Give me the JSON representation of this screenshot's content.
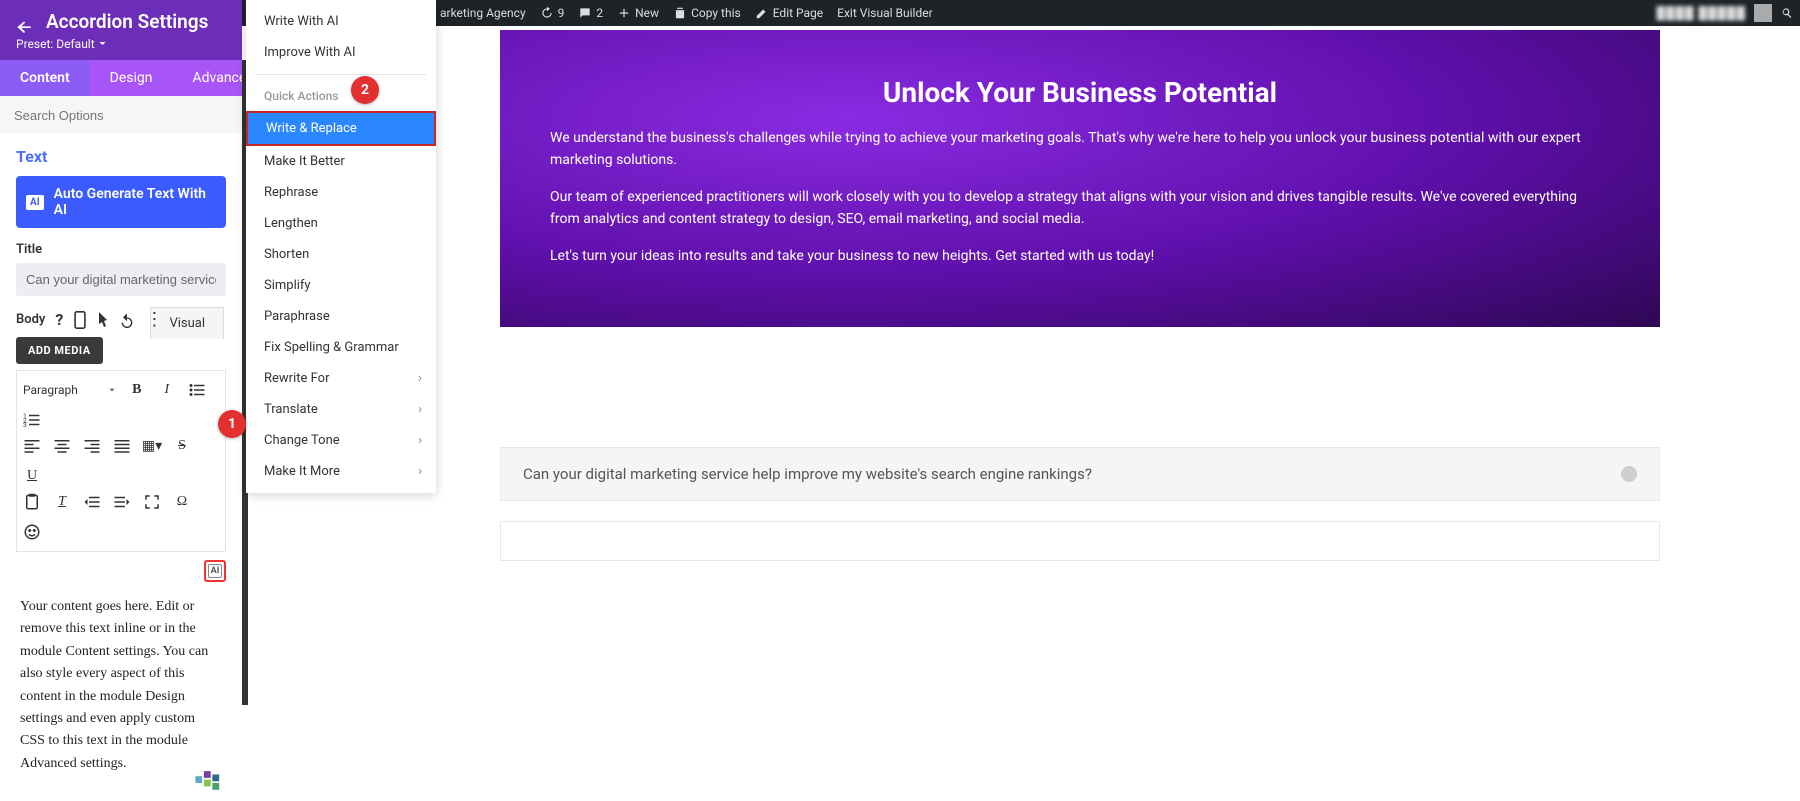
{
  "wpbar": {
    "site": "arketing Agency",
    "updates": "9",
    "comments": "2",
    "new": "New",
    "copy": "Copy this",
    "edit": "Edit Page",
    "exit": "Exit Visual Builder",
    "user_blur": "████ █████"
  },
  "panel": {
    "title": "Accordion Settings",
    "preset": "Preset: Default",
    "tabs": {
      "content": "Content",
      "design": "Design",
      "advanced": "Advanced"
    },
    "search_ph": "Search Options",
    "section": "Text",
    "auto_btn": "Auto Generate Text With AI",
    "title_lbl": "Title",
    "title_val": "Can your digital marketing service help improve my website's search engine rankings?",
    "body_lbl": "Body",
    "add_media": "ADD MEDIA",
    "visual": "Visual",
    "para": "Paragraph",
    "editor_body": "Your content goes here. Edit or remove this text inline or in the module Content settings. You can also style every aspect of this content in the module Design settings and even apply custom CSS to this text in the module Advanced settings."
  },
  "ai_menu": {
    "write_ai": "Write With AI",
    "improve_ai": "Improve With AI",
    "quick_head": "Quick Actions",
    "write_replace": "Write & Replace",
    "better": "Make It Better",
    "rephrase": "Rephrase",
    "lengthen": "Lengthen",
    "shorten": "Shorten",
    "simplify": "Simplify",
    "paraphrase": "Paraphrase",
    "fix": "Fix Spelling & Grammar",
    "rewrite": "Rewrite For",
    "translate": "Translate",
    "tone": "Change Tone",
    "more": "Make It More"
  },
  "preview": {
    "hero_title": "Unlock Your Business Potential",
    "hero_p1": "We understand the business's challenges while trying to achieve your marketing goals. That's why we're here to help you unlock your business potential with our expert marketing solutions.",
    "hero_p2": "Our team of experienced practitioners will work closely with you to develop a strategy that aligns with your vision and drives tangible results. We've covered everything from analytics and content strategy to design, SEO, email marketing, and social media.",
    "hero_p3": "Let's turn your ideas into results and take your business to new heights. Get started with us today!",
    "acc1": "Can your digital marketing service help improve my website's search engine rankings?"
  },
  "callouts": {
    "c1": "1",
    "c2": "2"
  },
  "icons": {
    "ai": "AI"
  }
}
